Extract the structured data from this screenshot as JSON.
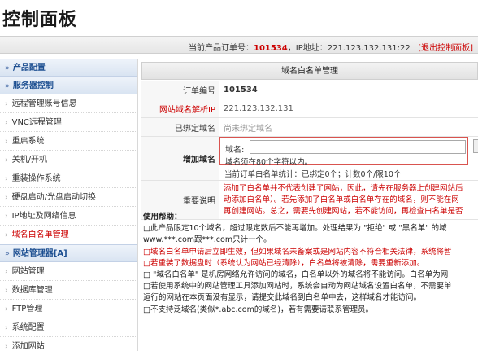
{
  "app": {
    "title": "控制面板"
  },
  "infobar": {
    "order_label": "当前产品订单号：",
    "order_no": "101534",
    "ip_label": "，IP地址：",
    "ip": "221.123.132.131:22",
    "exit": "[退出控制面板]"
  },
  "sidebar": {
    "sections": [
      {
        "label": "产品配置",
        "items": []
      },
      {
        "label": "服务器控制",
        "items": [
          {
            "label": "远程管理账号信息",
            "active": false
          },
          {
            "label": "VNC远程管理",
            "active": false
          },
          {
            "label": "重启系统",
            "active": false
          },
          {
            "label": "关机/开机",
            "active": false
          },
          {
            "label": "重装操作系统",
            "active": false
          },
          {
            "label": "硬盘启动/光盘启动切换",
            "active": false
          },
          {
            "label": "IP地址及网络信息",
            "active": false
          },
          {
            "label": "域名白名单管理",
            "active": true
          }
        ]
      },
      {
        "label": "网站管理器[A]",
        "items": [
          {
            "label": "网站管理",
            "active": false
          },
          {
            "label": "数据库管理",
            "active": false
          },
          {
            "label": "FTP管理",
            "active": false
          },
          {
            "label": "系统配置",
            "active": false
          },
          {
            "label": "添加网站",
            "active": false
          }
        ]
      }
    ]
  },
  "main": {
    "title": "域名白名单管理",
    "rows": {
      "order": {
        "label": "订单编号",
        "value": "101534"
      },
      "resolve": {
        "label": "网站域名解析IP",
        "value": "221.123.132.131"
      },
      "bound": {
        "label": "已绑定域名",
        "value": "尚未绑定域名"
      },
      "add": {
        "label": "增加域名",
        "field_label": "域名:",
        "field_value": "",
        "hint": "域名须在80个字符以内。",
        "stat": "当前订单白名单统计：已绑定0个；计数0个/限10个"
      },
      "important": {
        "label": "重要说明",
        "lines": [
          "添加了白名单并不代表创建了网站，因此，请先在服务器上创建网站后",
          "动添加白名单）。若先添加了白名单或白名单存在的域名，则不能在网",
          "再创建网站。总之，需要先创建网站，若不能访问，再检查白名单是否"
        ]
      }
    },
    "help": {
      "heading": "使用帮助：",
      "lines": [
        {
          "text": "□此产品限定10个域名，超过限定数后不能再增加。处理结果为 \"拒绝\" 或 \"黑名单\" 的域",
          "red": false
        },
        {
          "text": "www.***.com跟***.com只计一个。",
          "red": false
        },
        {
          "text": "□域名白名单申请后立即生效，但如果域名未备案或是网站内容不符合相关法律，系统将暂",
          "red": true
        },
        {
          "text": "□若重装了数据盘时（系统认为网站已经清除），白名单将被清除，需要重新添加。",
          "red": true
        },
        {
          "text": "□ \"域名白名单\" 是机房网络允许访问的域名，白名单以外的域名将不能访问。白名单为网",
          "red": false
        },
        {
          "text": "□若使用系统中的网站管理工具添加网站时，系统会自动为网站域名设置白名单，不需要单",
          "red": false
        },
        {
          "text": "运行的网站在本页面没有显示，请提交此域名到白名单中去，这样域名才能访问。",
          "red": false
        },
        {
          "text": "□不支持泛域名(类似*.abc.com的域名)，若有需要请联系管理员。",
          "red": false
        }
      ]
    }
  }
}
